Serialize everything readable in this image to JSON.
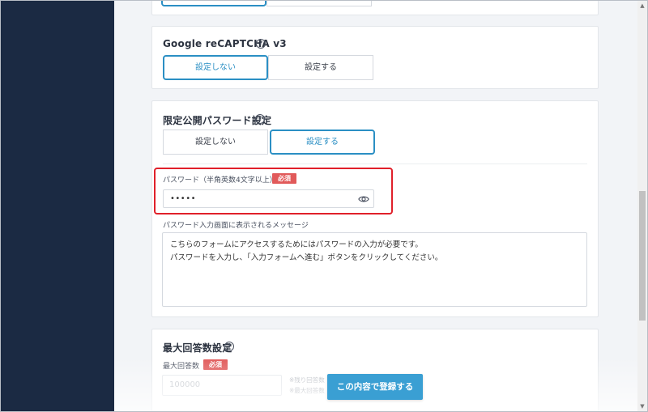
{
  "recaptcha": {
    "title": "Google reCAPTCHA v3",
    "options": [
      "設定しない",
      "設定する"
    ],
    "selected": "設定しない"
  },
  "password_section": {
    "title": "限定公開パスワード設定",
    "options": [
      "設定しない",
      "設定する"
    ],
    "selected": "設定する",
    "password_label": "パスワード（半角英数4文字以上）",
    "required_badge": "必須",
    "password_value": "•••••",
    "message_label": "パスワード入力画面に表示されるメッセージ",
    "message_line1": "こちらのフォームにアクセスするためにはパスワードの入力が必要です。",
    "message_line2": "パスワードを入力し、「入力フォームへ進む」ボタンをクリックしてください。"
  },
  "max_answers": {
    "title": "最大回答数設定",
    "field_label": "最大回答数",
    "required_badge": "必須",
    "placeholder": "100000",
    "note1": "※残り回答数",
    "note2": "※最大回答数"
  },
  "submit_label": "この内容で登録する",
  "icons": {
    "help": "help-circle-icon",
    "eye": "eye-icon"
  },
  "colors": {
    "sidebar": "#1b2a43",
    "accent": "#2b8fc4",
    "required": "#e15a5a",
    "highlight": "#e0202a",
    "submit": "#3a9fd3"
  }
}
